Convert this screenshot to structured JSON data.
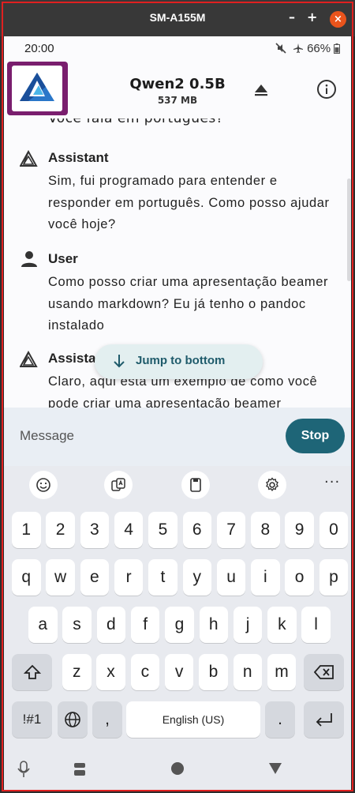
{
  "window": {
    "title": "SM-A155M",
    "minimize_label": "–",
    "maximize_label": "+",
    "close_label": "×"
  },
  "status_bar": {
    "time": "20:00",
    "battery": "66%"
  },
  "app_bar": {
    "model_name": "Qwen2 0.5B",
    "model_size": "537 MB"
  },
  "chat": {
    "partial_previous": "Você fala em português?",
    "messages": [
      {
        "sender": "Assistant",
        "text": "Sim, fui programado para entender e responder em português. Como posso ajudar você hoje?"
      },
      {
        "sender": "User",
        "text": "Como posso criar uma apresentação beamer usando markdown? Eu já tenho o pandoc instalado"
      },
      {
        "sender": "Assistant",
        "text": "Claro, aqui está um exemplo de como você pode criar uma apresentação beamer"
      }
    ],
    "jump_label": "Jump to bottom"
  },
  "composer": {
    "placeholder": "Message",
    "stop_label": "Stop"
  },
  "keyboard": {
    "number_row": [
      "1",
      "2",
      "3",
      "4",
      "5",
      "6",
      "7",
      "8",
      "9",
      "0"
    ],
    "row1": [
      "q",
      "w",
      "e",
      "r",
      "t",
      "y",
      "u",
      "i",
      "o",
      "p"
    ],
    "row2": [
      "a",
      "s",
      "d",
      "f",
      "g",
      "h",
      "j",
      "k",
      "l"
    ],
    "row3": [
      "z",
      "x",
      "c",
      "v",
      "b",
      "n",
      "m"
    ],
    "symbols_label": "!#1",
    "comma_label": ",",
    "space_label": "English (US)",
    "period_label": ".",
    "more_label": "···"
  },
  "colors": {
    "accent": "#1e6577",
    "logo_bg": "#7a1e6e",
    "window_close": "#e9541c"
  }
}
